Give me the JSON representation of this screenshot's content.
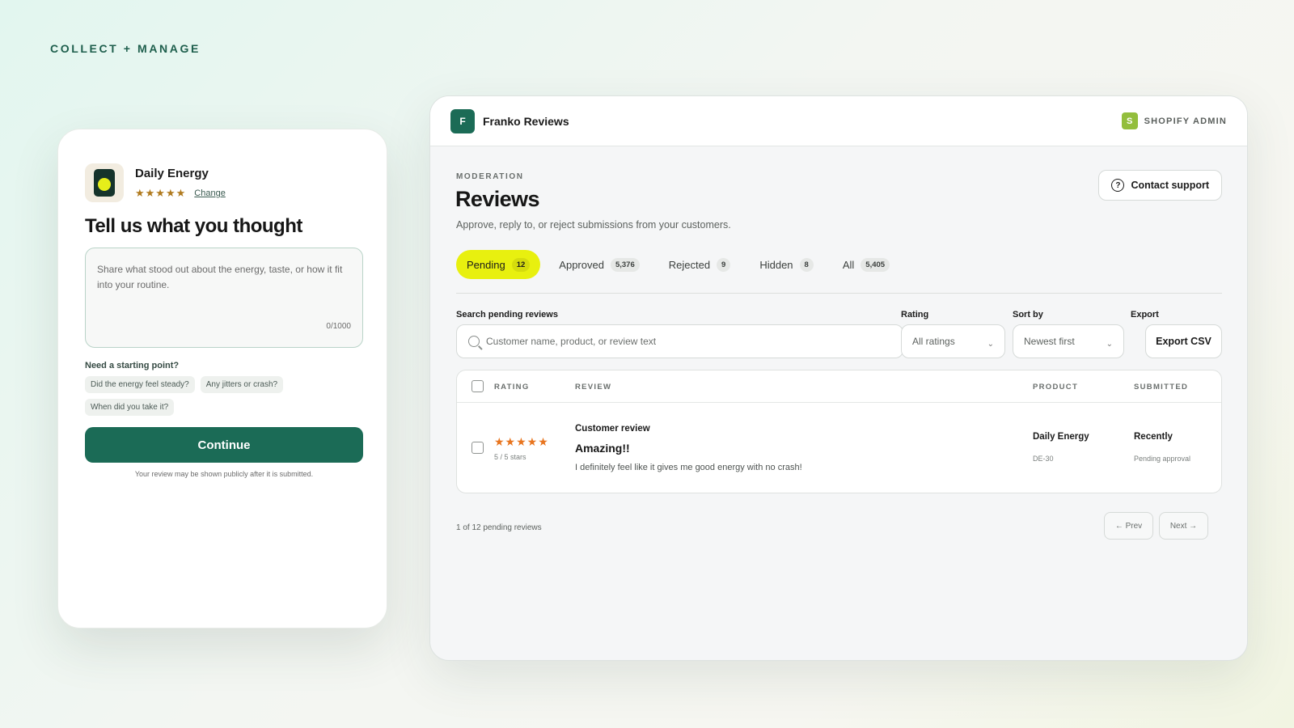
{
  "eyebrow": "COLLECT + MANAGE",
  "widget": {
    "product_name": "Daily Energy",
    "rating_stars": "★★★★★",
    "change_label": "Change",
    "title": "Tell us what you thought",
    "textarea_placeholder": "Share what stood out about the energy, taste, or how it fit into your routine.",
    "char_count": "0/1000",
    "prompt_label": "Need a starting point?",
    "prompt_chips": [
      "Did the energy feel steady?",
      "Any jitters or crash?",
      "When did you take it?"
    ],
    "continue_label": "Continue",
    "disclaimer": "Your review may be shown publicly after it is submitted."
  },
  "admin": {
    "brand_initial": "F",
    "brand_name": "Franko Reviews",
    "shopify_icon_letter": "S",
    "shopify_label": "SHOPIFY ADMIN",
    "section_label": "MODERATION",
    "title": "Reviews",
    "subtitle": "Approve, reply to, or reject submissions from your customers.",
    "support_label": "Contact support",
    "tabs": [
      {
        "label": "Pending",
        "count": "12",
        "active": true
      },
      {
        "label": "Approved",
        "count": "5,376"
      },
      {
        "label": "Rejected",
        "count": "9"
      },
      {
        "label": "Hidden",
        "count": "8"
      },
      {
        "label": "All",
        "count": "5,405"
      }
    ],
    "filters": {
      "search_label": "Search pending reviews",
      "search_placeholder": "Customer name, product, or review text",
      "rating_label": "Rating",
      "rating_value": "All ratings",
      "sort_label": "Sort by",
      "sort_value": "Newest first",
      "export_label": "Export",
      "export_button": "Export CSV"
    },
    "table": {
      "columns": [
        "RATING",
        "REVIEW",
        "PRODUCT",
        "SUBMITTED"
      ],
      "rows": [
        {
          "stars": "★★★★★",
          "stars_text": "5 / 5 stars",
          "kind": "Customer review",
          "title": "Amazing!!",
          "body": "I definitely feel like it gives me good energy with no crash!",
          "product": "Daily Energy",
          "sku": "DE-30",
          "submitted": "Recently",
          "status": "Pending approval"
        }
      ]
    },
    "pagination": {
      "summary": "1 of 12 pending reviews",
      "prev_label": "← Prev",
      "next_label": "Next →"
    }
  },
  "colors": {
    "brand_green": "#1b6b56",
    "active_tab": "#e8f00f",
    "star_orange": "#e8751f",
    "star_gold": "#b07a1e",
    "shopify_green": "#93be3d"
  }
}
